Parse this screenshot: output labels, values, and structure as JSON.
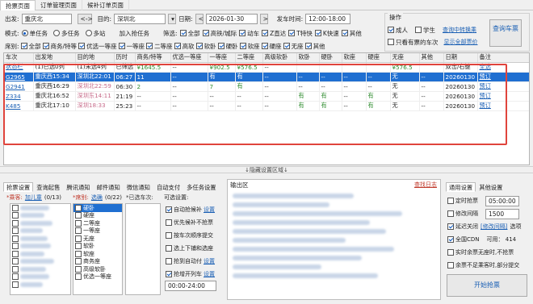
{
  "tabs": [
    "抢票页面",
    "订单管理页面",
    "候补订单页面"
  ],
  "search": {
    "from_label": "出发:",
    "from_value": "重庆北",
    "swap_label": "<->",
    "to_label": "目的:",
    "to_value": "深圳北",
    "date_label": "日期:",
    "date_value": "2026-01-30",
    "depart_time_label": "发车时间:",
    "depart_time_value": "12:00-18:00"
  },
  "mode": {
    "label": "模式:",
    "options": [
      "单任务",
      "多任务",
      "多站"
    ],
    "selected": 0,
    "add_task": "加入抢任务"
  },
  "filter": {
    "label": "筛选:",
    "items": [
      "全部",
      "高铁/城际",
      "动车",
      "Z直达",
      "T特快",
      "K快速",
      "其他"
    ]
  },
  "seat_row": {
    "label": "席别:",
    "items": [
      "全部",
      "商务/特等",
      "优选一等座",
      "一等座",
      "二等座",
      "高软",
      "软卧",
      "硬卧",
      "软座",
      "硬座",
      "无座",
      "其他"
    ]
  },
  "ops": {
    "title": "操作",
    "adult": "成人",
    "student": "学生",
    "query_transfer": "查询中转换乘",
    "only_tickets": "只看有票的车次",
    "show_all_fares": "显示全部票价",
    "query_button": "查询车票"
  },
  "table": {
    "headers": [
      "车次",
      "出发地",
      "目的地",
      "历时",
      "商务/特等",
      "优选一等座",
      "一等座",
      "二等座",
      "高级软卧",
      "软卧",
      "硬卧",
      "软座",
      "硬座",
      "无座",
      "其他",
      "日期",
      "备注"
    ],
    "price_row": [
      "状态栏",
      "(1)已选0列",
      "(1)未选4列",
      "已筛选",
      "¥1645.5",
      "--",
      "¥902.5",
      "¥576.5",
      "--",
      "",
      "",
      "",
      "",
      "¥576.5",
      "",
      "双击/右键",
      "全选"
    ],
    "rows": [
      [
        "G2965",
        "重庆西15:34",
        "深圳北22:01",
        "06:27",
        "11",
        "--",
        "有",
        "有",
        "--",
        "--",
        "--",
        "--",
        "--",
        "无",
        "--",
        "20260130",
        "预订"
      ],
      [
        "G2941",
        "重庆西16:29",
        "深圳北22:59",
        "06:30",
        "2",
        "--",
        "7",
        "有",
        "--",
        "--",
        "--",
        "--",
        "--",
        "无",
        "--",
        "20260130",
        "预订"
      ],
      [
        "Z334",
        "重庆北16:52",
        "深圳东14:11",
        "21:19",
        "--",
        "--",
        "--",
        "--",
        "--",
        "有",
        "有",
        "--",
        "有",
        "无",
        "--",
        "20260130",
        "预订"
      ],
      [
        "K485",
        "重庆北17:10",
        "深圳18:33",
        "25:23",
        "--",
        "--",
        "--",
        "--",
        "--",
        "有",
        "有",
        "--",
        "有",
        "无",
        "--",
        "20260130",
        "预订"
      ]
    ]
  },
  "splitter": "↓隐藏设置区域↓",
  "left_tabs": [
    "抢票设置",
    "查询起售",
    "腾讯通知",
    "邮件通知",
    "微信通知",
    "自动支付",
    "多任务设置"
  ],
  "passenger_label": "*乘客:",
  "passenger_add": "加儿童",
  "passenger_count": "(0/13)",
  "seat_label": "*席别:",
  "seat_link": "选确",
  "seat_count": "(0/22)",
  "train_label": "*已选车次:",
  "seats": [
    "硬卧",
    "硬座",
    "二等座",
    "一等座",
    "无座",
    "软卧",
    "软座",
    "商务座",
    "高级软卧",
    "优选一等座"
  ],
  "options_title": "可选设置:",
  "options": [
    {
      "label": "自动抢候补",
      "link": "设置",
      "on": true
    },
    {
      "label": "优先候补不抢票",
      "on": false
    },
    {
      "label": "按车次顺序提交",
      "on": false
    },
    {
      "label": "选上下铺和选座",
      "on": false
    },
    {
      "label": "抢到自动付",
      "link": "设置",
      "on": false
    },
    {
      "label": "抢增开列车",
      "link": "设置",
      "on": true
    }
  ],
  "time_range": "00:00-24:00",
  "output_title": "输出区",
  "output_link": "查找日志",
  "right_tabs": [
    "通用设置",
    "其他设置"
  ],
  "right_settings": {
    "timed": "定时抢票",
    "timed_value": "05:00:00",
    "interval": "修改间隔",
    "interval_value": "1500",
    "delay": "延迟关闭",
    "delay_link": "[修改间隔]",
    "delay_suffix": "选项",
    "cdn": "全国CDN",
    "cdn_count": "可用： 414",
    "realtime": "实时余票无座时,不抢票",
    "partial": "余票不足乘客时,部分提交",
    "start": "开始抢票"
  }
}
